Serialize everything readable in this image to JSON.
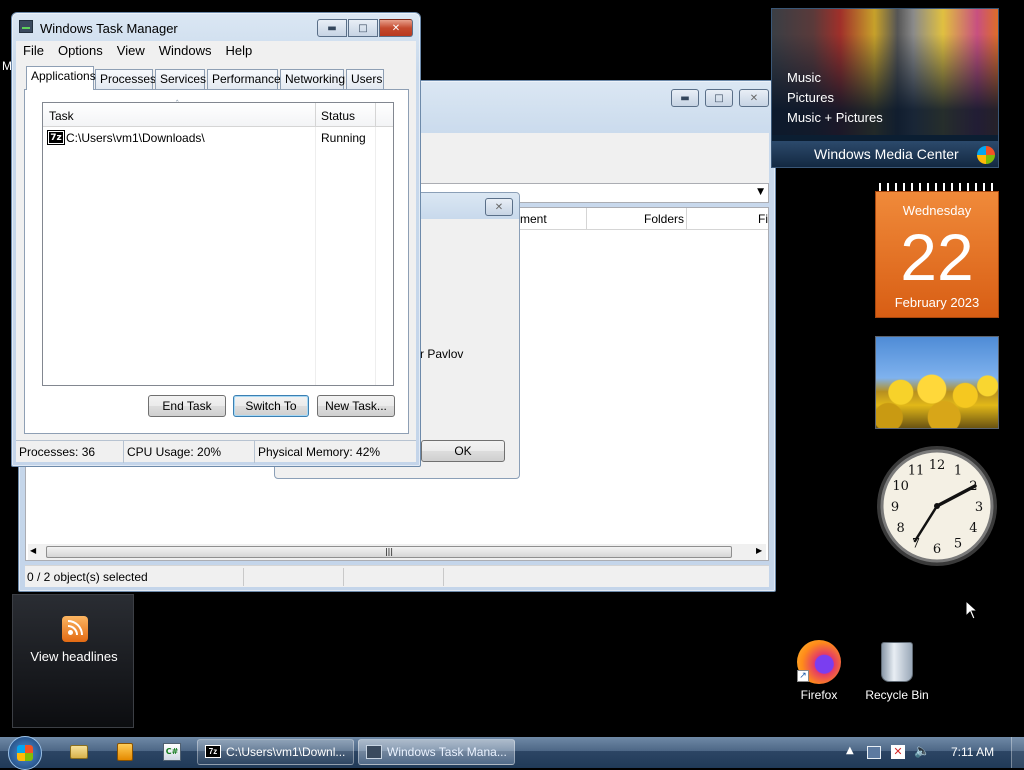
{
  "task_manager": {
    "title": "Windows Task Manager",
    "menu": [
      "File",
      "Options",
      "View",
      "Windows",
      "Help"
    ],
    "tabs": [
      "Applications",
      "Processes",
      "Services",
      "Performance",
      "Networking",
      "Users"
    ],
    "columns": {
      "task": "Task",
      "status": "Status"
    },
    "rows": [
      {
        "task": "C:\\Users\\vm1\\Downloads\\",
        "status": "Running",
        "icon": "7z"
      }
    ],
    "buttons": {
      "end_task": "End Task",
      "switch_to": "Switch To",
      "new_task": "New Task..."
    },
    "status": {
      "processes": "Processes: 36",
      "cpu": "CPU Usage: 20%",
      "memory": "Physical Memory: 42%"
    }
  },
  "explorer": {
    "columns": {
      "comment": "ment",
      "folders": "Folders",
      "fi": "Fi"
    },
    "status_text": "0 / 2 object(s) selected",
    "left_edge_label": "M"
  },
  "dialog": {
    "text": "Pavlov",
    "ok_label": "OK"
  },
  "media_center": {
    "items": [
      "Music",
      "Pictures",
      "Music + Pictures"
    ],
    "brand": "Windows Media Center"
  },
  "calendar": {
    "weekday": "Wednesday",
    "day": "22",
    "month_year": "February 2023"
  },
  "clock": {
    "numbers": [
      "12",
      "1",
      "2",
      "3",
      "4",
      "5",
      "6",
      "7",
      "8",
      "9",
      "10",
      "11"
    ]
  },
  "feed": {
    "label": "View headlines"
  },
  "desktop_icons": {
    "firefox": "Firefox",
    "recycle_bin": "Recycle Bin"
  },
  "taskbar": {
    "buttons": [
      "C:\\Users\\vm1\\Downl...",
      "Windows Task Mana..."
    ],
    "time": "7:11 AM"
  },
  "colors": {
    "taskbar": "#1f3f6b",
    "calendar": "#e8742a",
    "accent": "#3c7fb1"
  }
}
